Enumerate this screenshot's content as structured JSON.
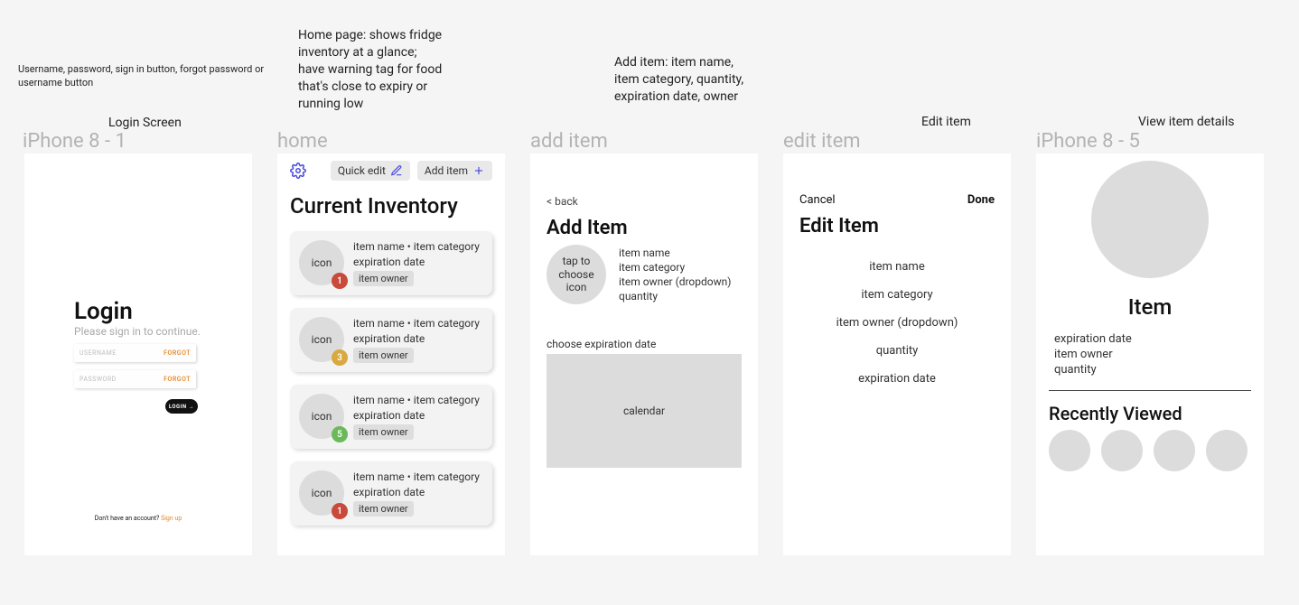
{
  "annotations": {
    "login": "Username, password, sign in button, forgot password or username button",
    "home": "Home page: shows fridge inventory at a glance; have warning tag for food that's close to expiry or running low",
    "add": "Add item: item name, item category, quantity, expiration date, owner",
    "edit": "Edit item",
    "view": "View item details"
  },
  "labels": {
    "login": "Login Screen"
  },
  "frame_names": {
    "f1": "iPhone 8 - 1",
    "f2": "home",
    "f3": "add item",
    "f4": "edit item",
    "f5": "iPhone 8 - 5"
  },
  "login": {
    "heading": "Login",
    "sub": "Please sign in to continue.",
    "username_ph": "USERNAME",
    "password_ph": "PASSWORD",
    "forgot": "FORGOT",
    "button": "LOGIN →",
    "no_account": "Don't have an account? ",
    "signup": "Sign up"
  },
  "home": {
    "quick_edit": "Quick edit",
    "add_item": "Add item",
    "heading": "Current Inventory",
    "items": [
      {
        "icon": "icon",
        "title": "item name • item category",
        "exp": "expiration date",
        "owner": "item owner",
        "count": "1",
        "color": "#c94a3b"
      },
      {
        "icon": "icon",
        "title": "item name • item category",
        "exp": "expiration date",
        "owner": "item owner",
        "count": "3",
        "color": "#d8a93e"
      },
      {
        "icon": "icon",
        "title": "item name • item category",
        "exp": "expiration date",
        "owner": "item owner",
        "count": "5",
        "color": "#6aba5a"
      },
      {
        "icon": "icon",
        "title": "item name • item category",
        "exp": "expiration date",
        "owner": "item owner",
        "count": "1",
        "color": "#c94a3b"
      }
    ]
  },
  "add": {
    "back": "< back",
    "heading": "Add Item",
    "choose_icon": "tap to choose icon",
    "fields": [
      "item name",
      "item category",
      "item owner (dropdown)",
      "quantity"
    ],
    "calendar_label": "choose expiration date",
    "calendar": "calendar"
  },
  "edit": {
    "cancel": "Cancel",
    "done": "Done",
    "heading": "Edit Item",
    "fields": [
      "item name",
      "item category",
      "item owner (dropdown)",
      "quantity",
      "expiration date"
    ]
  },
  "view": {
    "title": "Item",
    "fields": [
      "expiration date",
      "item owner",
      "quantity"
    ],
    "recent_heading": "Recently Viewed"
  },
  "colors": {
    "accent": "#4a4ae0",
    "orange": "#e58a2c"
  }
}
